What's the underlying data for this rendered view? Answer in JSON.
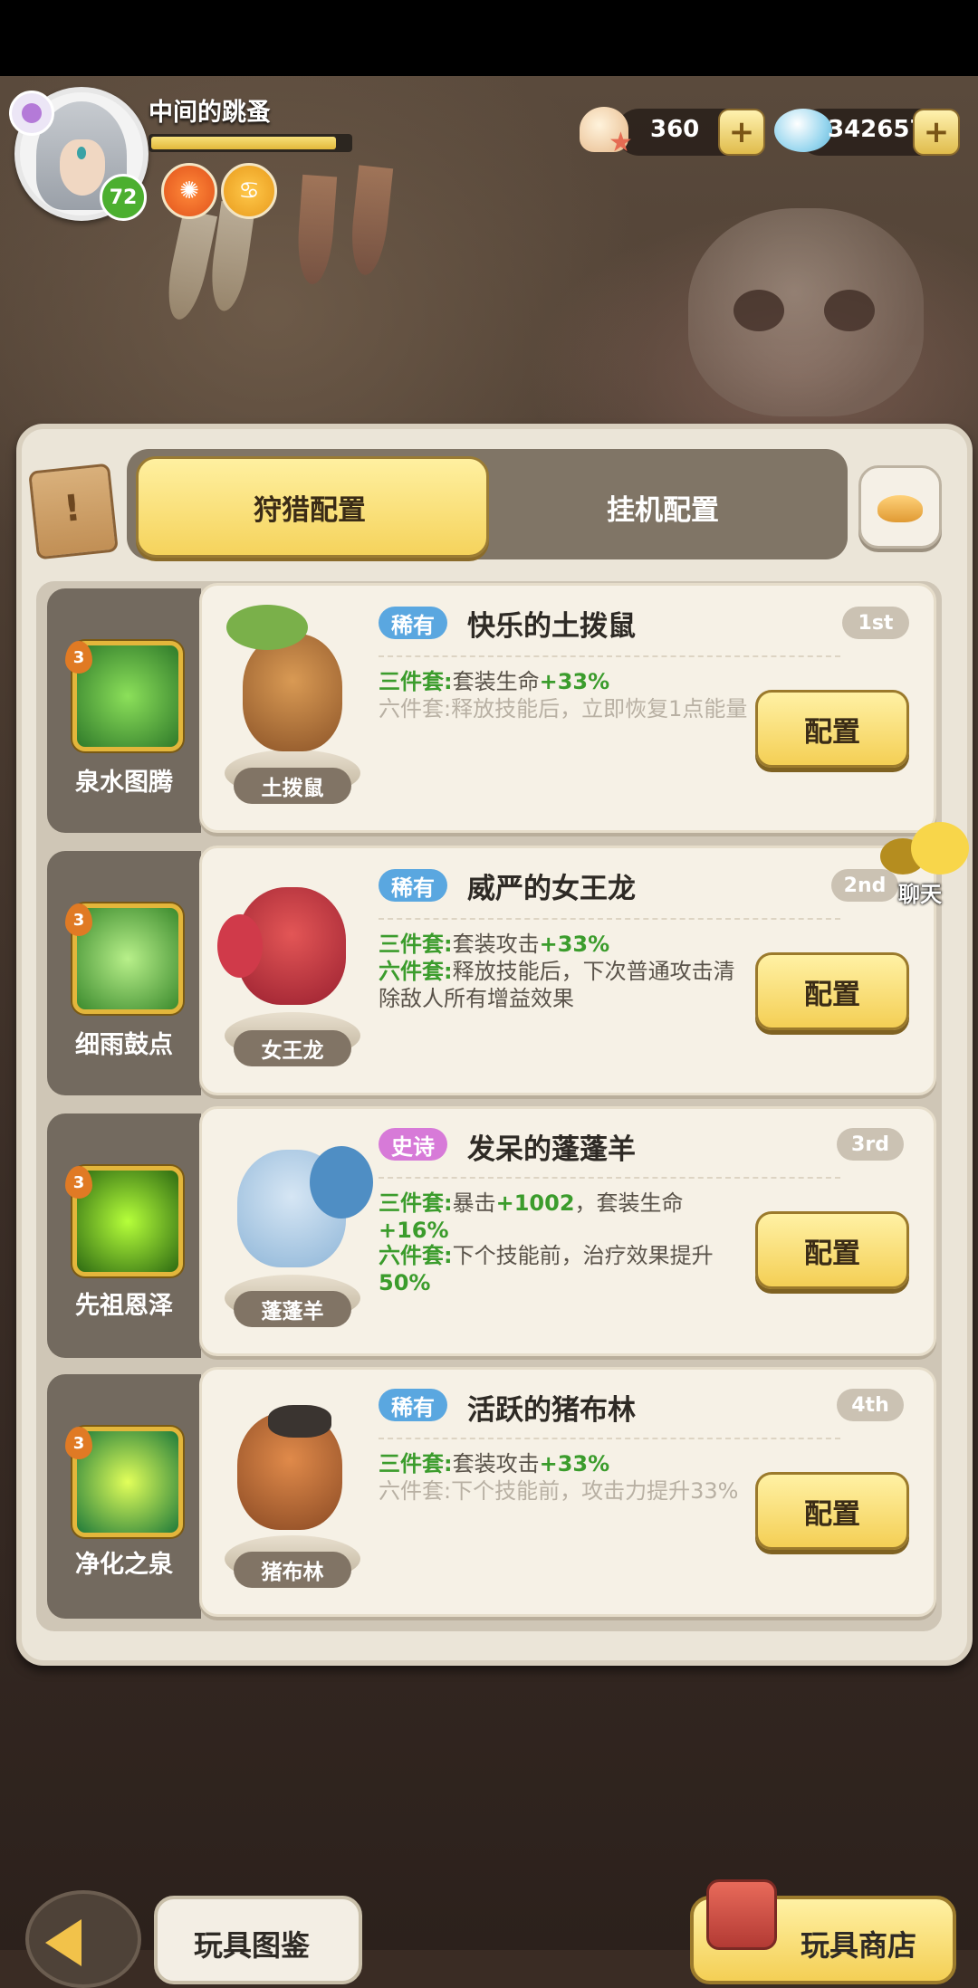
{
  "player": {
    "name": "中间的跳蚤",
    "level": "72",
    "xp_fraction": 0.93
  },
  "resources": [
    {
      "name": "shell-star",
      "value": "360"
    },
    {
      "name": "gem",
      "value": "342657"
    }
  ],
  "tabs": {
    "active": "狩猎配置",
    "inactive": "挂机配置"
  },
  "chat": {
    "label": "聊天"
  },
  "rows": [
    {
      "totem": {
        "name": "泉水图腾",
        "level": "3"
      },
      "pet": {
        "tag": "土拨鼠",
        "rarity": "稀有",
        "title": "快乐的土拨鼠",
        "rank": "1st"
      },
      "set3": {
        "label": "三件套:",
        "desc": "套装生命",
        "value": "+33%"
      },
      "set6": {
        "text": "六件套:释放技能后，立即恢复1点能量",
        "active": false
      },
      "button": "配置"
    },
    {
      "totem": {
        "name": "细雨鼓点",
        "level": "3"
      },
      "pet": {
        "tag": "女王龙",
        "rarity": "稀有",
        "title": "威严的女王龙",
        "rank": "2nd"
      },
      "set3": {
        "label": "三件套:",
        "desc": "套装攻击",
        "value": "+33%"
      },
      "set6": {
        "label": "六件套:",
        "desc": "释放技能后，下次普通攻击清除敌人所有增益效果",
        "active": true
      },
      "button": "配置"
    },
    {
      "totem": {
        "name": "先祖恩泽",
        "level": "3"
      },
      "pet": {
        "tag": "蓬蓬羊",
        "rarity": "史诗",
        "title": "发呆的蓬蓬羊",
        "rank": "3rd"
      },
      "set3": {
        "label": "三件套:",
        "desc": "暴击",
        "value": "+1002",
        "desc2": "，套装生命",
        "value2": "+16%"
      },
      "set6": {
        "label": "六件套:",
        "desc": "下个技能前，治疗效果提升",
        "value": "50%",
        "active": true
      },
      "button": "配置"
    },
    {
      "totem": {
        "name": "净化之泉",
        "level": "3"
      },
      "pet": {
        "tag": "猪布林",
        "rarity": "稀有",
        "title": "活跃的猪布林",
        "rank": "4th"
      },
      "set3": {
        "label": "三件套:",
        "desc": "套装攻击",
        "value": "+33%"
      },
      "set6": {
        "text": "六件套:下个技能前，攻击力提升33%",
        "active": false
      },
      "button": "配置"
    }
  ],
  "bottom": {
    "catalog": "玩具图鉴",
    "shop": "玩具商店"
  },
  "colors": {
    "rare": "#5aa7e0",
    "epic": "#d77ad8",
    "active_set": "#3b9c2c",
    "button": "#f4cf55"
  }
}
